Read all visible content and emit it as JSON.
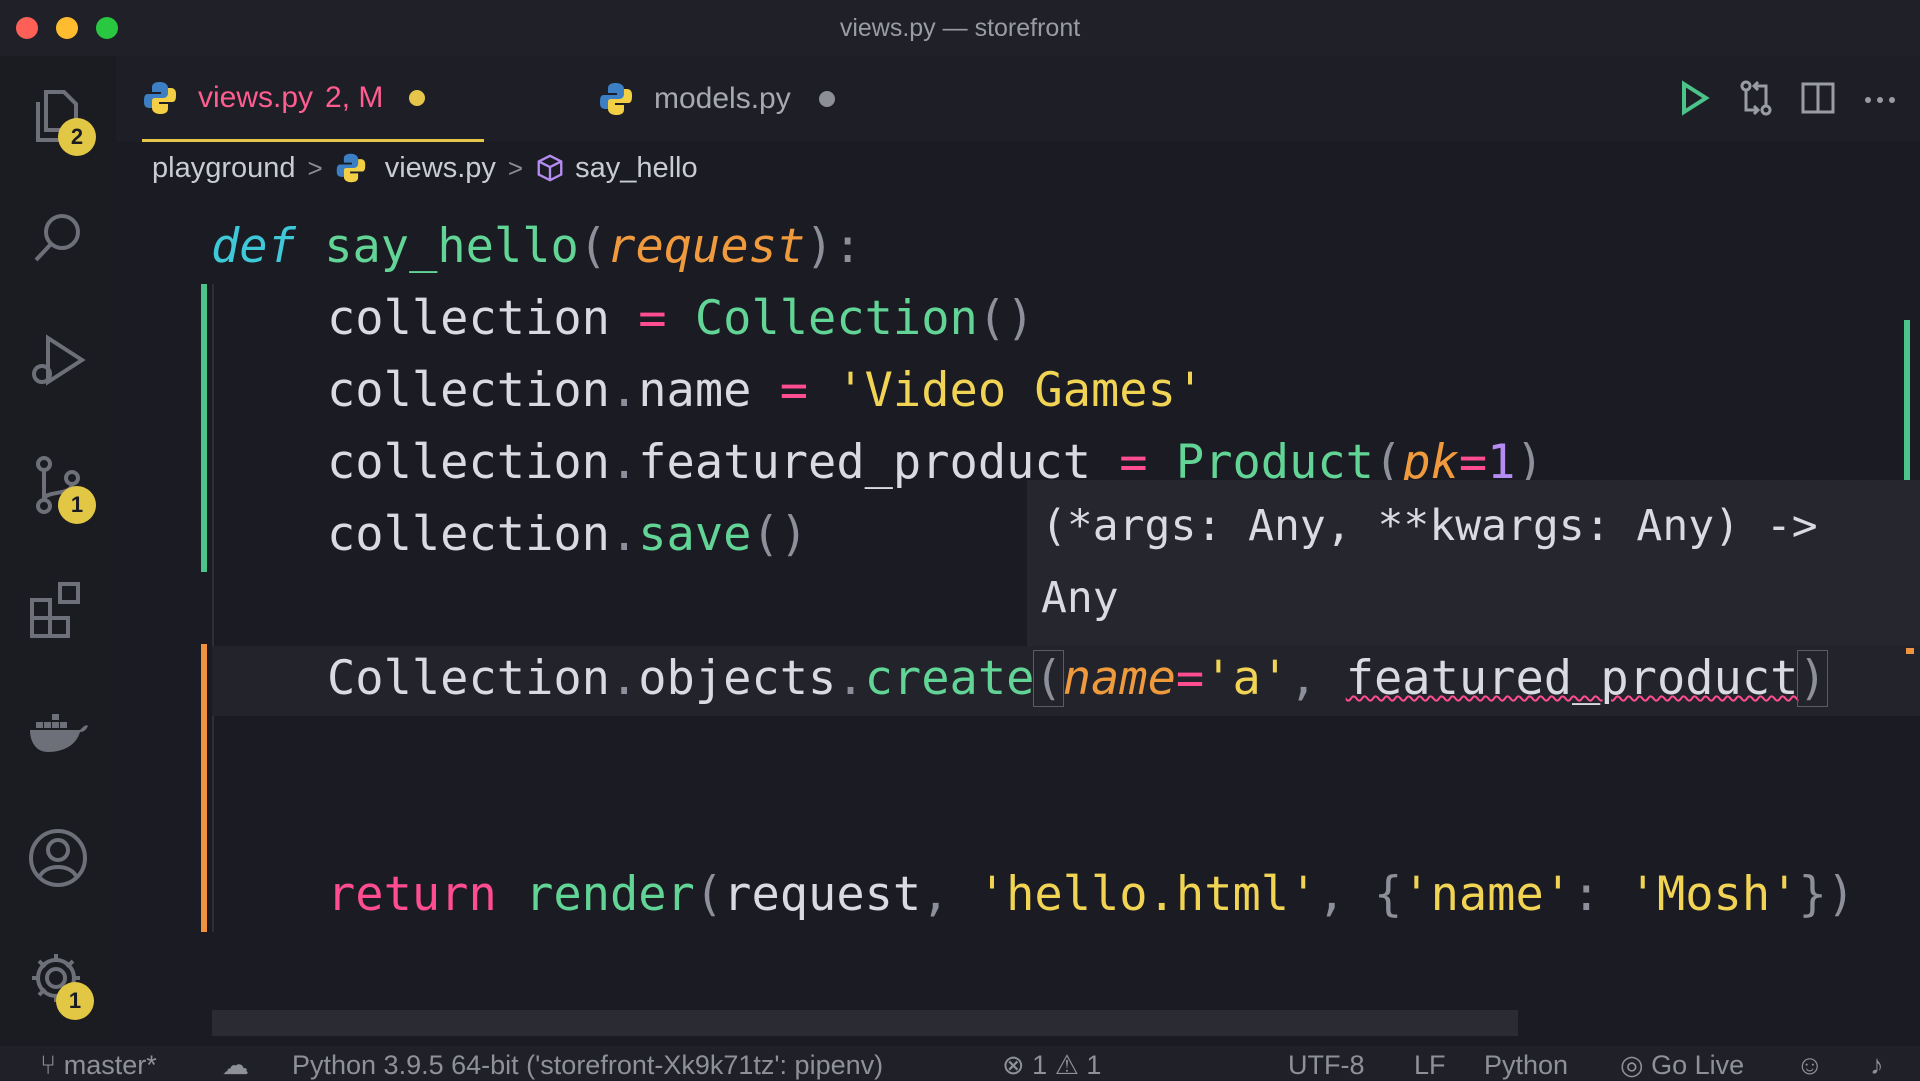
{
  "window": {
    "title": "views.py — storefront"
  },
  "activity_bar": {
    "explorer_badge": "2",
    "source_control_badge": "1",
    "settings_badge": "1"
  },
  "tabs": [
    {
      "name": "views.py",
      "status": "2, M"
    },
    {
      "name": "models.py"
    }
  ],
  "breadcrumb": {
    "folder": "playground",
    "file": "views.py",
    "symbol": "say_hello"
  },
  "code": {
    "l1": {
      "def": "def",
      "name": "say_hello",
      "open": "(",
      "param": "request",
      "close": "):"
    },
    "l2": {
      "a": "collection",
      "eq": " = ",
      "cls": "Collection",
      "p": "()"
    },
    "l3": {
      "a": "collection",
      "dot": ".",
      "b": "name",
      "eq": " = ",
      "str": "'Video Games'"
    },
    "l4": {
      "a": "collection",
      "dot": ".",
      "b": "featured_product",
      "eq": " = ",
      "cls": "Product",
      "open": "(",
      "kw": "pk",
      "eq2": "=",
      "num": "1",
      "close": ")"
    },
    "l5": {
      "a": "collection",
      "dot": ".",
      "fn": "save",
      "p": "()"
    },
    "l6": {
      "a": "Collection",
      "dot": ".",
      "b": "objects",
      "dot2": ".",
      "fn": "create",
      "open": "(",
      "kw": "name",
      "eq": "=",
      "str": "'a'",
      "comma": ", ",
      "c": "featured_product",
      "close": ")"
    },
    "l7": {
      "ret": "return",
      "fn": "render",
      "open": "(",
      "a": "request",
      "comma": ", ",
      "str": "'hello.html'",
      "comma2": ", ",
      "brace": "{",
      "k": "'name'",
      "colon": ": ",
      "v": "'Mosh'",
      "end": "})"
    }
  },
  "hover": {
    "line1": "(*args: Any, **kwargs: Any) ->",
    "line2": "Any"
  },
  "status_bar": {
    "branch": "master*",
    "interpreter": "Python 3.9.5 64-bit ('storefront-Xk9k71tz': pipenv)",
    "errors": "1",
    "warnings": "1",
    "encoding": "UTF-8",
    "eol": "LF",
    "language": "Python",
    "golive": "Go Live"
  },
  "colors": {
    "accent_tab": "#e5c64b",
    "added": "#4cc38a",
    "modified": "#f0923e",
    "badge": "#e2c744"
  },
  "icons": [
    "files-icon",
    "search-icon",
    "run-debug-icon",
    "source-control-icon",
    "extensions-icon",
    "docker-icon",
    "account-icon",
    "settings-gear-icon",
    "python-icon",
    "run-icon",
    "compare-icon",
    "split-editor-icon",
    "more-icon",
    "symbol-method-icon"
  ]
}
